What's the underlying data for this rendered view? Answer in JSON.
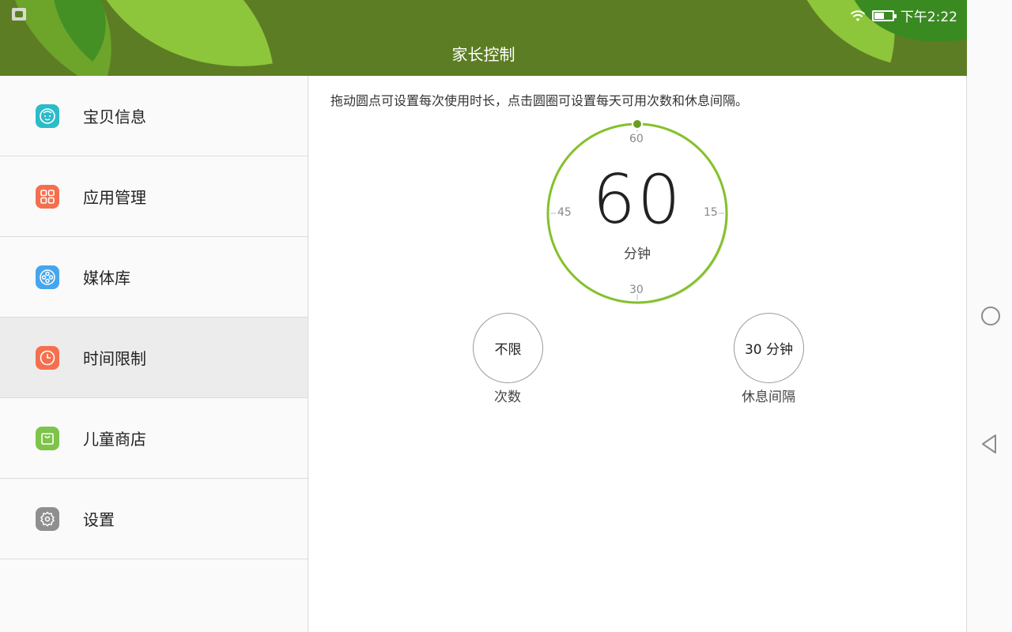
{
  "status_bar": {
    "time": "下午2:22"
  },
  "header": {
    "title": "家长控制"
  },
  "sidebar": {
    "items": [
      {
        "label": "宝贝信息",
        "icon": "baby-face-icon",
        "color": "#2bbcc8"
      },
      {
        "label": "应用管理",
        "icon": "apps-grid-icon",
        "color": "#f56f4e"
      },
      {
        "label": "媒体库",
        "icon": "film-reel-icon",
        "color": "#45a6ef"
      },
      {
        "label": "时间限制",
        "icon": "clock-icon",
        "color": "#f56f4e",
        "active": true
      },
      {
        "label": "儿童商店",
        "icon": "shopping-bag-icon",
        "color": "#7ec34a"
      },
      {
        "label": "设置",
        "icon": "gear-icon",
        "color": "#8f8f8f"
      }
    ]
  },
  "main": {
    "hint": "拖动圆点可设置每次使用时长，点击圆圈可设置每天可用次数和休息间隔。",
    "dial": {
      "value": "60",
      "unit": "分钟",
      "ticks": {
        "top": "60",
        "right": "15",
        "bottom": "30",
        "left": "45"
      },
      "accent": "#84c12b"
    },
    "times": {
      "value": "不限",
      "label": "次数"
    },
    "rest": {
      "value": "30 分钟",
      "label": "休息间隔"
    }
  }
}
